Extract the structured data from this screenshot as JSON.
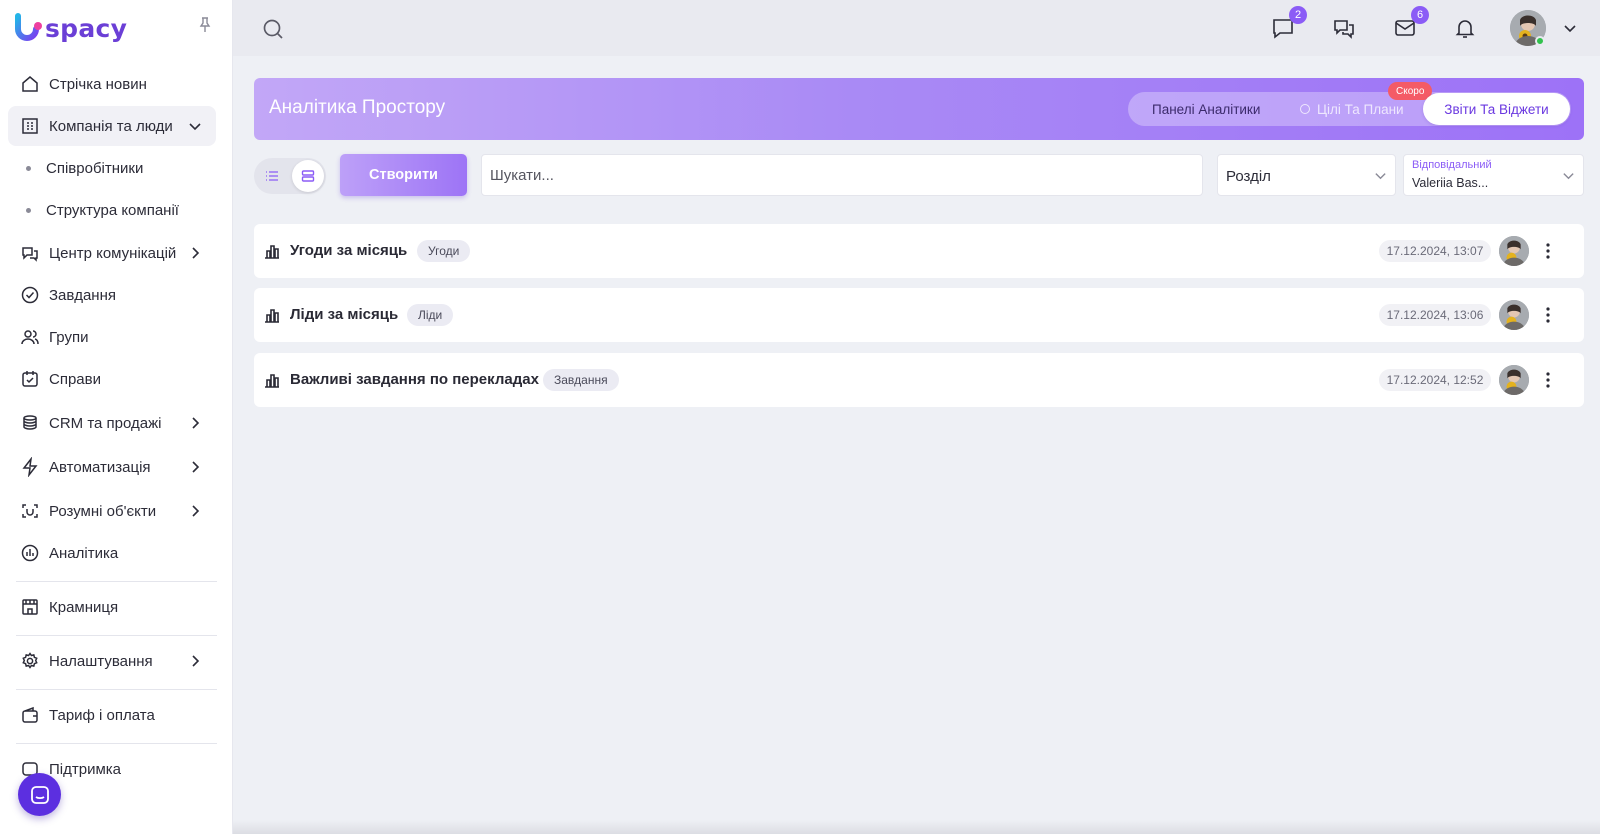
{
  "brand": {
    "name": "spacy",
    "accent": "#8b5cf6"
  },
  "sidebar": {
    "items": [
      {
        "label": "Стрічка новин",
        "icon": "home-icon"
      },
      {
        "label": "Компанія та люди",
        "icon": "building-icon",
        "expanded": true
      },
      {
        "label": "Центр комунікацій",
        "icon": "communication-icon"
      },
      {
        "label": "Завдання",
        "icon": "check-circle-icon"
      },
      {
        "label": "Групи",
        "icon": "users-icon"
      },
      {
        "label": "Справи",
        "icon": "calendar-check-icon"
      },
      {
        "label": "CRM та продажі",
        "icon": "coins-icon"
      },
      {
        "label": "Автоматизація",
        "icon": "lightning-icon"
      },
      {
        "label": "Розумні об'єкти",
        "icon": "smart-object-icon"
      },
      {
        "label": "Аналітика",
        "icon": "analytics-icon"
      },
      {
        "label": "Крамниця",
        "icon": "store-icon"
      },
      {
        "label": "Налаштування",
        "icon": "gear-icon"
      },
      {
        "label": "Тариф і оплата",
        "icon": "wallet-icon"
      },
      {
        "label": "Підтримка",
        "icon": "support-icon"
      }
    ],
    "subitems": [
      "Співробітники",
      "Структура компанії"
    ]
  },
  "topbar": {
    "badges": {
      "chat": "2",
      "mail": "6"
    }
  },
  "banner": {
    "title": "Аналітика Простору",
    "tabs": {
      "panels": "Панелі Аналітики",
      "goals": "Цілі Та Плани",
      "reports": "Звіти Та Віджети",
      "soon": "Скоро"
    }
  },
  "toolbar": {
    "create_label": "Створити",
    "search_placeholder": "Шукати...",
    "section_value": "Розділ",
    "responsible_label": "Відповідальний",
    "responsible_value": "Valeriia Bas..."
  },
  "reports": [
    {
      "title": "Угоди за місяць",
      "tag": "Угоди",
      "date": "17.12.2024, 13:07"
    },
    {
      "title": "Ліди за місяць",
      "tag": "Ліди",
      "date": "17.12.2024, 13:06"
    },
    {
      "title": "Важливі завдання по перекладах",
      "tag": "Завдання",
      "date": "17.12.2024, 12:52"
    }
  ]
}
